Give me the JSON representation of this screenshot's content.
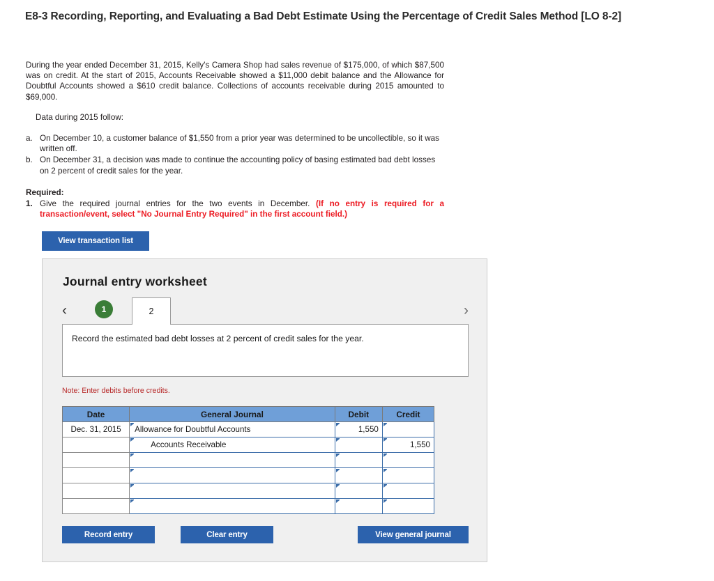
{
  "exercise": {
    "title": "E8-3 Recording, Reporting, and Evaluating a Bad Debt Estimate Using the Percentage of Credit Sales Method [LO 8-2]"
  },
  "problem": {
    "intro": "During the year ended December 31, 2015, Kelly's Camera Shop had sales revenue of $175,000, of which $87,500 was on credit. At the start of 2015, Accounts Receivable showed a $11,000 debit balance and the Allowance for Doubtful Accounts showed a $610 credit balance. Collections of accounts receivable during 2015 amounted to $69,000.",
    "data_follow": "Data during 2015 follow:",
    "items": [
      {
        "marker": "a.",
        "text": "On December 10, a customer balance of $1,550 from a prior year was determined to be uncollectible, so it was written off."
      },
      {
        "marker": "b.",
        "text": "On December 31, a decision was made to continue the accounting policy of basing estimated bad debt losses on 2 percent of credit sales for the year."
      }
    ],
    "required_label": "Required:",
    "required_marker": "1.",
    "required_text": "Give the required journal entries for the two events in December.",
    "required_red": "(If no entry is required for a transaction/event, select \"No Journal Entry Required\" in the first account field.)"
  },
  "buttons": {
    "view_transaction_list": "View transaction list",
    "record_entry": "Record entry",
    "clear_entry": "Clear entry",
    "view_general_journal": "View general journal"
  },
  "worksheet": {
    "title": "Journal entry worksheet",
    "prev_chevron": "‹",
    "next_chevron": "›",
    "tabs": [
      {
        "label": "1",
        "state": "completed"
      },
      {
        "label": "2",
        "state": "active"
      }
    ],
    "instruction": "Record the estimated bad debt losses at 2 percent of credit sales for the year.",
    "note": "Note: Enter debits before credits."
  },
  "journal": {
    "headers": {
      "date": "Date",
      "general_journal": "General Journal",
      "debit": "Debit",
      "credit": "Credit"
    },
    "rows": [
      {
        "date": "Dec. 31, 2015",
        "account": "Allowance for Doubtful Accounts",
        "indent": false,
        "debit": "1,550",
        "credit": ""
      },
      {
        "date": "",
        "account": "Accounts Receivable",
        "indent": true,
        "debit": "",
        "credit": "1,550"
      },
      {
        "date": "",
        "account": "",
        "indent": false,
        "debit": "",
        "credit": ""
      },
      {
        "date": "",
        "account": "",
        "indent": false,
        "debit": "",
        "credit": ""
      },
      {
        "date": "",
        "account": "",
        "indent": false,
        "debit": "",
        "credit": ""
      },
      {
        "date": "",
        "account": "",
        "indent": false,
        "debit": "",
        "credit": ""
      }
    ]
  },
  "colors": {
    "button_blue": "#2c62ad",
    "table_header_blue": "#6f9fd8",
    "tab_green": "#3a7d37",
    "note_red": "#b82b2b",
    "required_red": "#ec1c24",
    "panel_grey": "#f0f0f0",
    "input_border_blue": "#3a6ca8"
  }
}
